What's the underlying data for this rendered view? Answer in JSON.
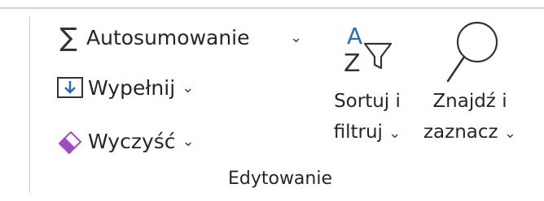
{
  "group": {
    "label": "Edytowanie"
  },
  "autosum": {
    "label": "Autosumowanie",
    "icon": "sigma-icon",
    "chevron": "⌄"
  },
  "fill": {
    "label": "Wypełnij",
    "icon": "fill-down-icon",
    "chevron": "⌄"
  },
  "clear": {
    "label": "Wyczyść",
    "icon": "eraser-icon",
    "chevron": "⌄"
  },
  "sort_filter": {
    "line1": "Sortuj i",
    "line2": "filtruj",
    "icon": "sort-filter-icon",
    "chevron": "⌄"
  },
  "find_select": {
    "line1": "Znajdź i",
    "line2": "zaznacz",
    "icon": "magnifier-icon",
    "chevron": "⌄"
  },
  "colors": {
    "accent": "#2b6cb0",
    "eraser": "#a24ac4",
    "text": "#262626"
  }
}
